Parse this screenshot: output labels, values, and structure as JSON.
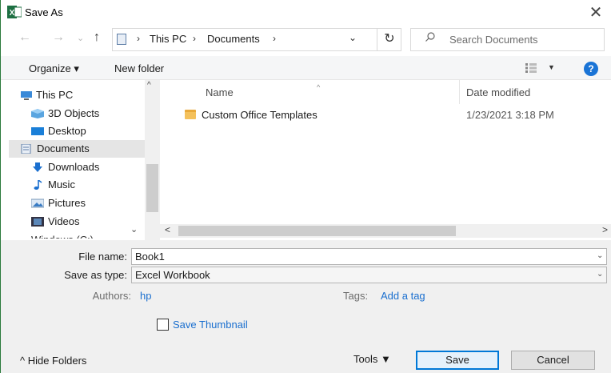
{
  "window": {
    "title": "Save As",
    "app_icon": "excel-icon",
    "close_glyph": "✕"
  },
  "nav": {
    "back_glyph": "←",
    "forward_glyph": "→",
    "recent_glyph": "⌄",
    "up_glyph": "↑",
    "breadcrumb": [
      "This PC",
      "Documents"
    ],
    "separator": "›",
    "dropdown_glyph": "⌄",
    "refresh_glyph": "↻",
    "search_placeholder": "Search Documents"
  },
  "toolbar": {
    "organize": "Organize ▾",
    "new_folder": "New folder",
    "view_dropdown": "▼",
    "help": "?"
  },
  "sidebar": {
    "items": [
      {
        "label": "This PC",
        "icon": "pc-icon"
      },
      {
        "label": "3D Objects",
        "icon": "cube-icon"
      },
      {
        "label": "Desktop",
        "icon": "desktop-icon"
      },
      {
        "label": "Documents",
        "icon": "documents-icon"
      },
      {
        "label": "Downloads",
        "icon": "download-icon"
      },
      {
        "label": "Music",
        "icon": "music-icon"
      },
      {
        "label": "Pictures",
        "icon": "pictures-icon"
      },
      {
        "label": "Videos",
        "icon": "videos-icon"
      },
      {
        "label": "Windows (C:)",
        "icon": "drive-icon"
      }
    ],
    "selected": "Documents"
  },
  "file_list": {
    "sort_glyph": "^",
    "columns": [
      "Name",
      "Date modified"
    ],
    "rows": [
      {
        "name": "Custom Office Templates",
        "date_modified": "1/23/2021 3:18 PM",
        "icon": "folder-icon"
      }
    ]
  },
  "scroll": {
    "up": "^",
    "down": "⌄",
    "left": "<",
    "right": ">"
  },
  "form": {
    "file_name_label": "File name:",
    "file_name_value": "Book1",
    "save_type_label": "Save as type:",
    "save_type_value": "Excel Workbook",
    "combo_glyph": "⌄",
    "authors_label": "Authors:",
    "authors_value": "hp",
    "tags_label": "Tags:",
    "tags_value": "Add a tag",
    "thumbnail_label": "Save Thumbnail",
    "thumbnail_checked": false
  },
  "footer": {
    "hide_folders": "^ Hide Folders",
    "tools": "Tools ▼",
    "save": "Save",
    "cancel": "Cancel"
  },
  "colors": {
    "accent": "#0078d7",
    "selection": "#cce8ff",
    "excel_green": "#1d6f42",
    "link": "#1a6fcf"
  }
}
